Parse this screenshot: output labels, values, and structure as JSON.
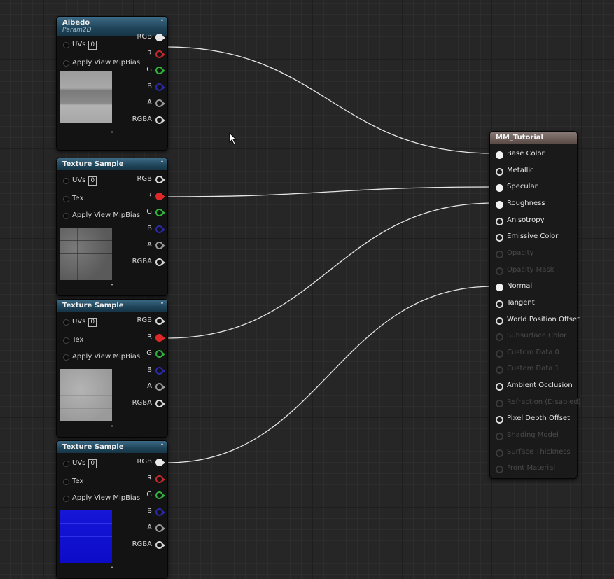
{
  "albedo_node": {
    "title": "Albedo",
    "subtitle": "Param2D",
    "inputs": [
      {
        "label": "UVs",
        "value": "0"
      },
      {
        "label": "Apply View MipBias"
      }
    ],
    "outputs": [
      {
        "label": "RGB",
        "color": "#e8e8e8",
        "connected": true
      },
      {
        "label": "R",
        "color": "#c8282a",
        "connected": false
      },
      {
        "label": "G",
        "color": "#2fb43a",
        "connected": false
      },
      {
        "label": "B",
        "color": "#2a2aa8",
        "connected": false
      },
      {
        "label": "A",
        "color": "#9a9a9a",
        "connected": false
      },
      {
        "label": "RGBA",
        "color": "#d8d8d8",
        "connected": false
      }
    ],
    "collapse_icon": "chevron-up-icon",
    "expand_icon": "chevron-down-icon"
  },
  "texture_nodes": [
    {
      "title": "Texture Sample",
      "uvs_label": "UVs",
      "uvs_value": "0",
      "tex_label": "Tex",
      "mip_label": "Apply View MipBias",
      "outputs": [
        {
          "label": "RGB",
          "color": "#d8d8d8",
          "connected": false
        },
        {
          "label": "R",
          "color": "#e02828",
          "connected": true
        },
        {
          "label": "G",
          "color": "#2fb43a",
          "connected": false
        },
        {
          "label": "B",
          "color": "#2a2aa8",
          "connected": false
        },
        {
          "label": "A",
          "color": "#9a9a9a",
          "connected": false
        },
        {
          "label": "RGBA",
          "color": "#d8d8d8",
          "connected": false
        }
      ],
      "preview": "grey-brick"
    },
    {
      "title": "Texture Sample",
      "uvs_label": "UVs",
      "uvs_value": "0",
      "tex_label": "Tex",
      "mip_label": "Apply View MipBias",
      "outputs": [
        {
          "label": "RGB",
          "color": "#d8d8d8",
          "connected": false
        },
        {
          "label": "R",
          "color": "#e02828",
          "connected": true
        },
        {
          "label": "G",
          "color": "#2fb43a",
          "connected": false
        },
        {
          "label": "B",
          "color": "#2a2aa8",
          "connected": false
        },
        {
          "label": "A",
          "color": "#9a9a9a",
          "connected": false
        },
        {
          "label": "RGBA",
          "color": "#d8d8d8",
          "connected": false
        }
      ],
      "preview": "light-grey"
    },
    {
      "title": "Texture Sample",
      "uvs_label": "UVs",
      "uvs_value": "0",
      "tex_label": "Tex",
      "mip_label": "Apply View MipBias",
      "outputs": [
        {
          "label": "RGB",
          "color": "#e8e8e8",
          "connected": true
        },
        {
          "label": "R",
          "color": "#c8282a",
          "connected": false
        },
        {
          "label": "G",
          "color": "#2fb43a",
          "connected": false
        },
        {
          "label": "B",
          "color": "#2a2aa8",
          "connected": false
        },
        {
          "label": "A",
          "color": "#9a9a9a",
          "connected": false
        },
        {
          "label": "RGBA",
          "color": "#d8d8d8",
          "connected": false
        }
      ],
      "preview": "normal-blue"
    }
  ],
  "material_node": {
    "title": "MM_Tutorial",
    "pins": [
      {
        "label": "Base Color",
        "enabled": true,
        "connected": true
      },
      {
        "label": "Metallic",
        "enabled": true,
        "connected": false
      },
      {
        "label": "Specular",
        "enabled": true,
        "connected": true
      },
      {
        "label": "Roughness",
        "enabled": true,
        "connected": true
      },
      {
        "label": "Anisotropy",
        "enabled": true,
        "connected": false
      },
      {
        "label": "Emissive Color",
        "enabled": true,
        "connected": false
      },
      {
        "label": "Opacity",
        "enabled": false,
        "connected": false
      },
      {
        "label": "Opacity Mask",
        "enabled": false,
        "connected": false
      },
      {
        "label": "Normal",
        "enabled": true,
        "connected": true
      },
      {
        "label": "Tangent",
        "enabled": true,
        "connected": false
      },
      {
        "label": "World Position Offset",
        "enabled": true,
        "connected": false
      },
      {
        "label": "Subsurface Color",
        "enabled": false,
        "connected": false
      },
      {
        "label": "Custom Data 0",
        "enabled": false,
        "connected": false
      },
      {
        "label": "Custom Data 1",
        "enabled": false,
        "connected": false
      },
      {
        "label": "Ambient Occlusion",
        "enabled": true,
        "connected": false
      },
      {
        "label": "Refraction (Disabled)",
        "enabled": false,
        "connected": false
      },
      {
        "label": "Pixel Depth Offset",
        "enabled": true,
        "connected": false
      },
      {
        "label": "Shading Model",
        "enabled": false,
        "connected": false
      },
      {
        "label": "Surface Thickness",
        "enabled": false,
        "connected": false
      },
      {
        "label": "Front Material",
        "enabled": false,
        "connected": false
      }
    ]
  },
  "colors": {
    "graph_bg": "#262626",
    "wire": "#e6e6e6",
    "node_header": "#24506a",
    "material_header": "#6e605b"
  }
}
